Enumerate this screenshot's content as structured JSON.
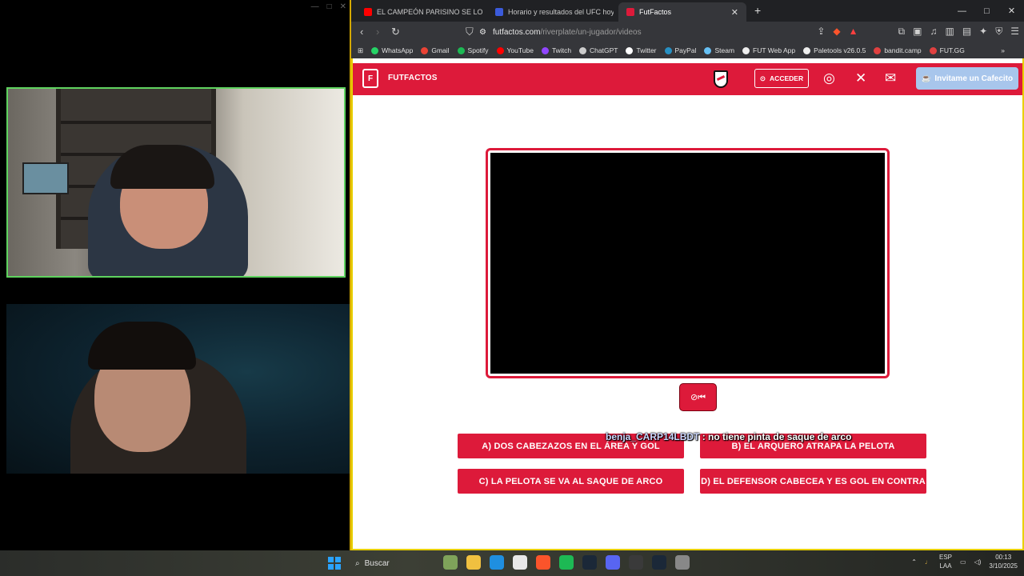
{
  "left_window_controls": [
    "—",
    "□",
    "✕"
  ],
  "browser": {
    "tabs": [
      {
        "title": "EL CAMPEÓN PARISINO SE LO DIO V",
        "fav_color": "#ff0000"
      },
      {
        "title": "Horario y resultados del UFC hoy | Sc",
        "fav_color": "#3b5bdb"
      },
      {
        "title": "FutFactos",
        "fav_color": "#dd1a3a"
      }
    ],
    "new_tab": "+",
    "window_controls": [
      "—",
      "□",
      "✕"
    ],
    "url_domain": "futfactos.com",
    "url_path": "/riverplate/un-jugador/videos",
    "bookmarks": [
      {
        "label": "WhatsApp",
        "color": "#25d366"
      },
      {
        "label": "Gmail",
        "color": "#ea4335"
      },
      {
        "label": "Spotify",
        "color": "#1db954"
      },
      {
        "label": "YouTube",
        "color": "#ff0000"
      },
      {
        "label": "Twitch",
        "color": "#9146ff"
      },
      {
        "label": "ChatGPT",
        "color": "#cccccc"
      },
      {
        "label": "Twitter",
        "color": "#ffffff"
      },
      {
        "label": "PayPal",
        "color": "#2790c3"
      },
      {
        "label": "Steam",
        "color": "#66c0f4"
      },
      {
        "label": "FUT Web App",
        "color": "#eeeeee"
      },
      {
        "label": "Paletools v26.0.5",
        "color": "#eeeeee"
      },
      {
        "label": "bandit.camp",
        "color": "#e04040"
      },
      {
        "label": "FUT.GG",
        "color": "#e04040"
      }
    ],
    "bookmarks_more": "»"
  },
  "site": {
    "brand": "FUTFACTOS",
    "login_label": "ACCEDER",
    "cafecito_label": "Invitame un Cafecito",
    "accent": "#dd1a3a",
    "answers": [
      "A) DOS CABEZAZOS EN EL ÁREA Y GOL",
      "B) EL ARQUERO ATRAPA LA PELOTA",
      "C) LA PELOTA SE VA AL SAQUE DE ARCO",
      "D) EL DEFENSOR CABECEA Y ES GOL EN CONTRA"
    ],
    "chat": {
      "user": "benja_CARP14LBDT",
      "message": ": no tiene pinta de saque de arco"
    }
  },
  "taskbar": {
    "search_label": "Buscar",
    "lang_top": "ESP",
    "lang_bottom": "LAA",
    "time": "00:13",
    "date": "3/10/2025",
    "app_colors": [
      "#7fa35a",
      "#f0c040",
      "#1f8fe0",
      "#e8e8e8",
      "#fb542b",
      "#1db954",
      "#1b2838",
      "#5865f2",
      "#3a3a3a",
      "#1b2838",
      "#888888"
    ]
  }
}
